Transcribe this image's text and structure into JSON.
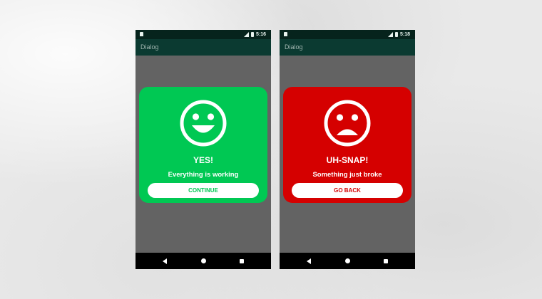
{
  "colors": {
    "status_bar": "#06231c",
    "action_bar": "#0b3a31",
    "screen_background": "#636363",
    "success": "#00c853",
    "error": "#d50000",
    "button_background": "#ffffff"
  },
  "screens": [
    {
      "status_bar": {
        "icons": [
          "sd-card-icon",
          "signal-icon",
          "battery-icon"
        ],
        "time": "5:16"
      },
      "app_bar": {
        "title": "Dialog"
      },
      "dialog": {
        "variant": "success",
        "icon": "happy-face-icon",
        "title": "YES!",
        "message": "Everything is working",
        "button_label": "CONTINUE"
      },
      "nav_bar": {
        "icons": [
          "back-icon",
          "home-icon",
          "recents-icon"
        ]
      }
    },
    {
      "status_bar": {
        "icons": [
          "sd-card-icon",
          "signal-icon",
          "battery-icon"
        ],
        "time": "5:18"
      },
      "app_bar": {
        "title": "Dialog"
      },
      "dialog": {
        "variant": "error",
        "icon": "sad-face-icon",
        "title": "UH-SNAP!",
        "message": "Something just broke",
        "button_label": "GO BACK"
      },
      "nav_bar": {
        "icons": [
          "back-icon",
          "home-icon",
          "recents-icon"
        ]
      }
    }
  ]
}
